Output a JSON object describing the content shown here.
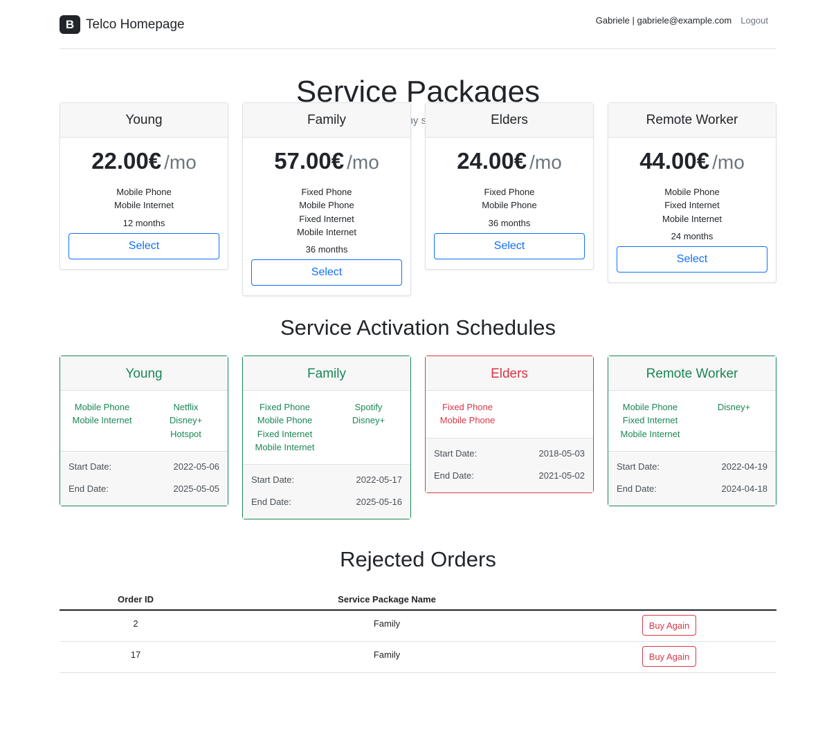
{
  "header": {
    "brand_logo": "B",
    "brand_title": "Telco Homepage",
    "user_info": "Gabriele | gabriele@example.com",
    "logout_label": "Logout"
  },
  "hero": {
    "title": "Service Packages",
    "subtitle": "Select from one of our many service packages available."
  },
  "packages": [
    {
      "name": "Young",
      "price": "22.00€",
      "period": "/mo",
      "services": [
        "Mobile Phone",
        "Mobile Internet"
      ],
      "duration": "12 months",
      "button": "Select"
    },
    {
      "name": "Family",
      "price": "57.00€",
      "period": "/mo",
      "services": [
        "Fixed Phone",
        "Mobile Phone",
        "Fixed Internet",
        "Mobile Internet"
      ],
      "duration": "36 months",
      "button": "Select"
    },
    {
      "name": "Elders",
      "price": "24.00€",
      "period": "/mo",
      "services": [
        "Fixed Phone",
        "Mobile Phone"
      ],
      "duration": "36 months",
      "button": "Select"
    },
    {
      "name": "Remote Worker",
      "price": "44.00€",
      "period": "/mo",
      "services": [
        "Mobile Phone",
        "Fixed Internet",
        "Mobile Internet"
      ],
      "duration": "24 months",
      "button": "Select"
    }
  ],
  "schedules_title": "Service Activation Schedules",
  "schedules": [
    {
      "name": "Young",
      "status": "active",
      "services": [
        "Mobile Phone",
        "Mobile Internet"
      ],
      "addons": [
        "Netflix",
        "Disney+",
        "Hotspot"
      ],
      "start_label": "Start Date:",
      "start_date": "2022-05-06",
      "end_label": "End Date:",
      "end_date": "2025-05-05"
    },
    {
      "name": "Family",
      "status": "active",
      "services": [
        "Fixed Phone",
        "Mobile Phone",
        "Fixed Internet",
        "Mobile Internet"
      ],
      "addons": [
        "Spotify",
        "Disney+"
      ],
      "start_label": "Start Date:",
      "start_date": "2022-05-17",
      "end_label": "End Date:",
      "end_date": "2025-05-16"
    },
    {
      "name": "Elders",
      "status": "expired",
      "services": [
        "Fixed Phone",
        "Mobile Phone"
      ],
      "addons": [],
      "start_label": "Start Date:",
      "start_date": "2018-05-03",
      "end_label": "End Date:",
      "end_date": "2021-05-02"
    },
    {
      "name": "Remote Worker",
      "status": "active",
      "services": [
        "Mobile Phone",
        "Fixed Internet",
        "Mobile Internet"
      ],
      "addons": [
        "Disney+"
      ],
      "start_label": "Start Date:",
      "start_date": "2022-04-19",
      "end_label": "End Date:",
      "end_date": "2024-04-18"
    }
  ],
  "rejected": {
    "title": "Rejected Orders",
    "columns": [
      "Order ID",
      "Service Package Name",
      ""
    ],
    "rows": [
      {
        "order_id": "2",
        "package": "Family",
        "action": "Buy Again"
      },
      {
        "order_id": "17",
        "package": "Family",
        "action": "Buy Again"
      }
    ]
  },
  "colors": {
    "primary": "#0d6efd",
    "success": "#198754",
    "danger": "#dc3545",
    "muted": "#6c757d"
  }
}
